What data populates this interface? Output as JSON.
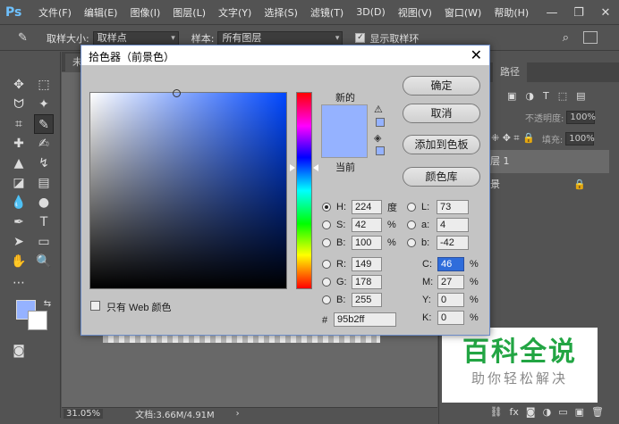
{
  "app": {
    "logo": "Ps"
  },
  "menu": [
    "文件(F)",
    "编辑(E)",
    "图像(I)",
    "图层(L)",
    "文字(Y)",
    "选择(S)",
    "滤镜(T)",
    "3D(D)",
    "视图(V)",
    "窗口(W)",
    "帮助(H)"
  ],
  "window_controls": {
    "minimize": "—",
    "restore": "❐",
    "close": "✕"
  },
  "options_bar": {
    "sample_size_label": "取样大小:",
    "sample_size_value": "取样点",
    "sample_label": "样本:",
    "sample_value": "所有图层",
    "show_ring_label": "显示取样环"
  },
  "document": {
    "tab_label": "未",
    "zoom": "31.05%",
    "doc_info": "文档:3.66M/4.91M"
  },
  "right_panel": {
    "tab_paths": "路径",
    "opacity_label": "不透明度:",
    "opacity_value": "100%",
    "fill_label": "填充:",
    "fill_value": "100%",
    "layer1": "图层 1",
    "layer_bg": "背景"
  },
  "watermark": {
    "title": "百科全说",
    "subtitle": "助你轻松解决"
  },
  "dialog": {
    "title": "拾色器（前景色）",
    "close": "✕",
    "new_label": "新的",
    "current_label": "当前",
    "buttons": {
      "ok": "确定",
      "cancel": "取消",
      "add_swatch": "添加到色板",
      "color_library": "颜色库"
    },
    "hsb": {
      "h": "224",
      "s": "42",
      "b": "100",
      "h_unit": "度",
      "s_unit": "%",
      "b_unit": "%"
    },
    "rgb": {
      "r": "149",
      "g": "178",
      "b": "255"
    },
    "lab": {
      "l": "73",
      "a": "4",
      "b": "-42"
    },
    "cmyk": {
      "c": "46",
      "m": "27",
      "y": "0",
      "k": "0",
      "unit": "%"
    },
    "labels": {
      "H": "H:",
      "S": "S:",
      "B": "B:",
      "R": "R:",
      "G": "G:",
      "B2": "B:",
      "L": "L:",
      "a": "a:",
      "b": "b:",
      "C": "C:",
      "M": "M:",
      "Y": "Y:",
      "K": "K:"
    },
    "web_only_label": "只有 Web 颜色",
    "hash": "#",
    "hex": "95b2ff"
  },
  "colors": {
    "foreground": "#95b2ff",
    "background": "#ffffff"
  }
}
